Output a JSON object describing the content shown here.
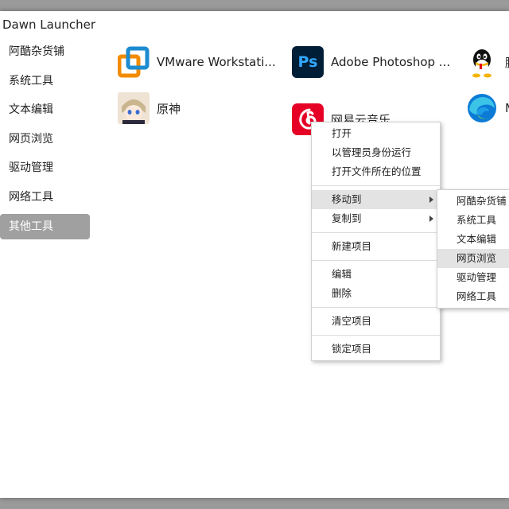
{
  "window": {
    "title": "Dawn Launcher"
  },
  "sidebar": {
    "items": [
      {
        "label": "阿酷杂货铺"
      },
      {
        "label": "系统工具"
      },
      {
        "label": "文本编辑"
      },
      {
        "label": "网页浏览"
      },
      {
        "label": "驱动管理"
      },
      {
        "label": "网络工具"
      },
      {
        "label": "其他工具",
        "active": true
      }
    ]
  },
  "apps": [
    {
      "label": "VMware Workstati...",
      "icon": "vmware-icon"
    },
    {
      "label": "Adobe Photoshop ...",
      "icon": "photoshop-icon",
      "icon_text": "Ps"
    },
    {
      "label": "腾",
      "icon": "qq-icon"
    },
    {
      "label": "原神",
      "icon": "genshin-icon"
    },
    {
      "label": "网易云音乐",
      "icon": "netease-music-icon"
    },
    {
      "label": "M",
      "icon": "edge-icon"
    }
  ],
  "context_menu": {
    "items": [
      {
        "label": "打开"
      },
      {
        "label": "以管理员身份运行"
      },
      {
        "label": "打开文件所在的位置"
      },
      {
        "label": "移动到",
        "submenu": true,
        "highlighted": true
      },
      {
        "label": "复制到",
        "submenu": true
      },
      {
        "label": "新建项目"
      },
      {
        "label": "编辑"
      },
      {
        "label": "删除"
      },
      {
        "label": "清空项目"
      },
      {
        "label": "锁定项目"
      }
    ]
  },
  "submenu": {
    "items": [
      {
        "label": "阿酷杂货铺"
      },
      {
        "label": "系统工具"
      },
      {
        "label": "文本编辑"
      },
      {
        "label": "网页浏览",
        "highlighted": true
      },
      {
        "label": "驱动管理"
      },
      {
        "label": "网络工具"
      }
    ]
  },
  "colors": {
    "sidebar_active_bg": "#a0a0a0",
    "menu_highlight": "#e3e3e3",
    "photoshop_bg": "#001e36",
    "photoshop_fg": "#31a8ff",
    "netease_red": "#e60026",
    "vmware_blue": "#1d8bd1",
    "vmware_orange": "#f38b00"
  }
}
